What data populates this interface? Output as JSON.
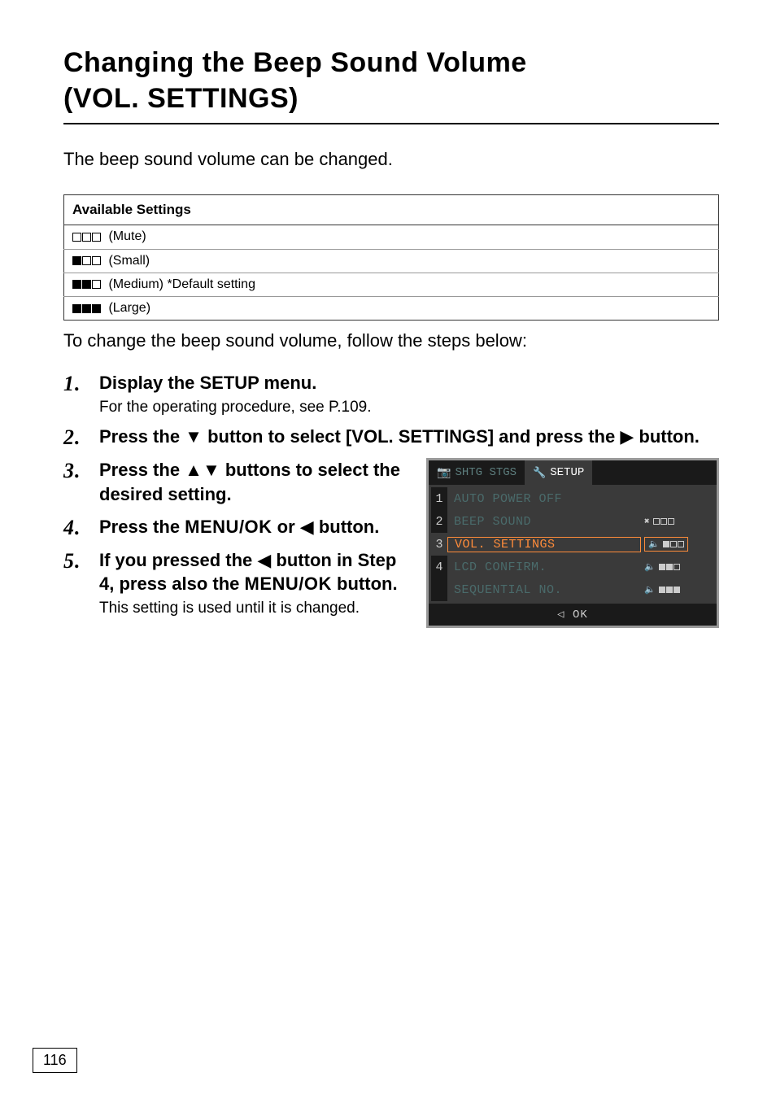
{
  "title_line1": "Changing the Beep Sound Volume",
  "title_line2": "(VOL. SETTINGS)",
  "intro": "The beep sound volume can be changed.",
  "settings_header": "Available Settings",
  "settings": [
    {
      "fill": 0,
      "label": "(Mute)"
    },
    {
      "fill": 1,
      "label": "(Small)"
    },
    {
      "fill": 2,
      "label": "(Medium) *Default setting"
    },
    {
      "fill": 3,
      "label": "(Large)"
    }
  ],
  "followup": "To change the beep sound volume, follow the steps below:",
  "steps": {
    "s1": {
      "num": "1",
      "head": "Display the SETUP menu.",
      "sub": "For the operating procedure, see P.109."
    },
    "s2": {
      "num": "2",
      "head_pre": "Press the ",
      "head_post": " button to select [VOL. SETTINGS] and press the ",
      "head_end": " button."
    },
    "s3": {
      "num": "3",
      "head_pre": "Press the ",
      "head_post": " buttons to select the desired setting."
    },
    "s4": {
      "num": "4",
      "head_pre": "Press the ",
      "menuok": "MENU/OK",
      "head_mid": " or ",
      "head_end": " button."
    },
    "s5": {
      "num": "5",
      "head_pre": "If you pressed the ",
      "head_mid": " button in Step 4, press also the ",
      "menuok": "MENU/OK",
      "head_end": " button.",
      "sub": "This setting is used until it is changed."
    }
  },
  "screenshot": {
    "tab_left": "SHTG STGS",
    "tab_right": "SETUP",
    "rows": [
      {
        "n": "1",
        "label": "AUTO POWER OFF",
        "dim": true,
        "fill": null
      },
      {
        "n": "2",
        "label": "BEEP SOUND",
        "dim": true,
        "fill": 0,
        "mute": true
      },
      {
        "n": "3",
        "label": "VOL. SETTINGS",
        "dim": false,
        "fill": 1
      },
      {
        "n": "4",
        "label": "LCD CONFIRM.",
        "dim": true,
        "fill": 2
      },
      {
        "n": "",
        "label": "SEQUENTIAL NO.",
        "dim": true,
        "fill": 3
      }
    ],
    "footer": "OK",
    "footer_glyph": "◁"
  },
  "page_number": "116"
}
